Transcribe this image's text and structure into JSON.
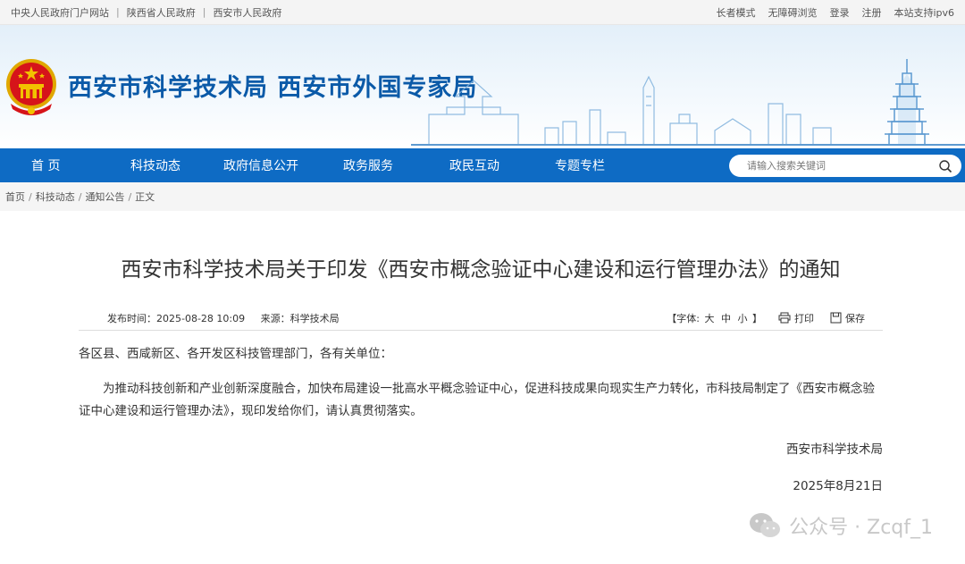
{
  "topbar": {
    "links": [
      "中央人民政府门户网站",
      "陕西省人民政府",
      "西安市人民政府"
    ],
    "right": [
      "长者模式",
      "无障碍浏览",
      "登录",
      "注册",
      "本站支持ipv6"
    ]
  },
  "banner": {
    "title": "西安市科学技术局 西安市外国专家局"
  },
  "nav": {
    "items": [
      "首 页",
      "科技动态",
      "政府信息公开",
      "政务服务",
      "政民互动",
      "专题专栏"
    ],
    "search_placeholder": "请输入搜索关键词"
  },
  "breadcrumb": [
    "首页",
    "科技动态",
    "通知公告",
    "正文"
  ],
  "article": {
    "title": "西安市科学技术局关于印发《西安市概念验证中心建设和运行管理办法》的通知",
    "publish_time": "发布时间：2025-08-28 10:09",
    "source": "来源：科学技术局",
    "font_size_label": "【字体:",
    "font_sizes": [
      "大",
      "中",
      "小"
    ],
    "font_size_close": "】",
    "print_label": "打印",
    "save_label": "保存",
    "salutation": "各区县、西咸新区、各开发区科技管理部门，各有关单位：",
    "paragraph": "为推动科技创新和产业创新深度融合，加快布局建设一批高水平概念验证中心，促进科技成果向现实生产力转化，市科技局制定了《西安市概念验证中心建设和运行管理办法》，现印发给你们，请认真贯彻落实。",
    "signature_org": "西安市科学技术局",
    "signature_date": "2025年8月21日"
  },
  "watermark": {
    "text": "公众号 · Zcqf_1"
  },
  "colors": {
    "nav_blue": "#0e6bc4",
    "title_blue": "#0b5aa8",
    "emblem_red": "#d6141a",
    "emblem_gold": "#f2c200"
  }
}
